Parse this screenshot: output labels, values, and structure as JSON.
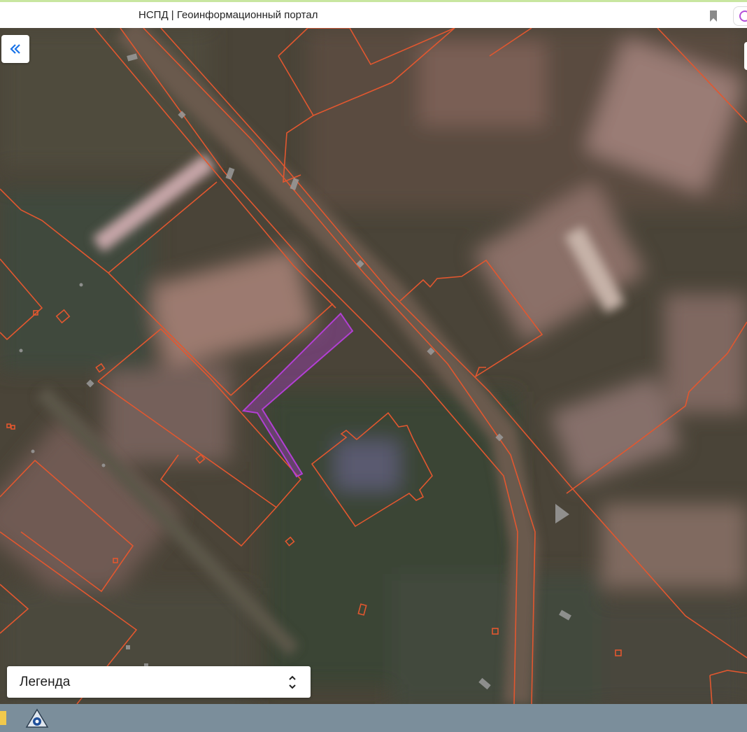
{
  "browser": {
    "tab_title": "НСПД | Геоинформационный портал",
    "bookmark_icon": "bookmark-icon",
    "assistant_icon": "alice-assistant-icon"
  },
  "map": {
    "collapse_icon": "double-chevron-left-icon",
    "parcel_outline_color": "#e2572f",
    "selected_parcel_color": "#b23fd4",
    "navigation_arrow_icon": "triangle-right-icon"
  },
  "legend": {
    "label": "Легенда",
    "toggle_icon": "chevron-up-down-icon"
  },
  "taskbar": {
    "folder_icon": "folder-icon",
    "app_icon": "gis-app-icon"
  }
}
